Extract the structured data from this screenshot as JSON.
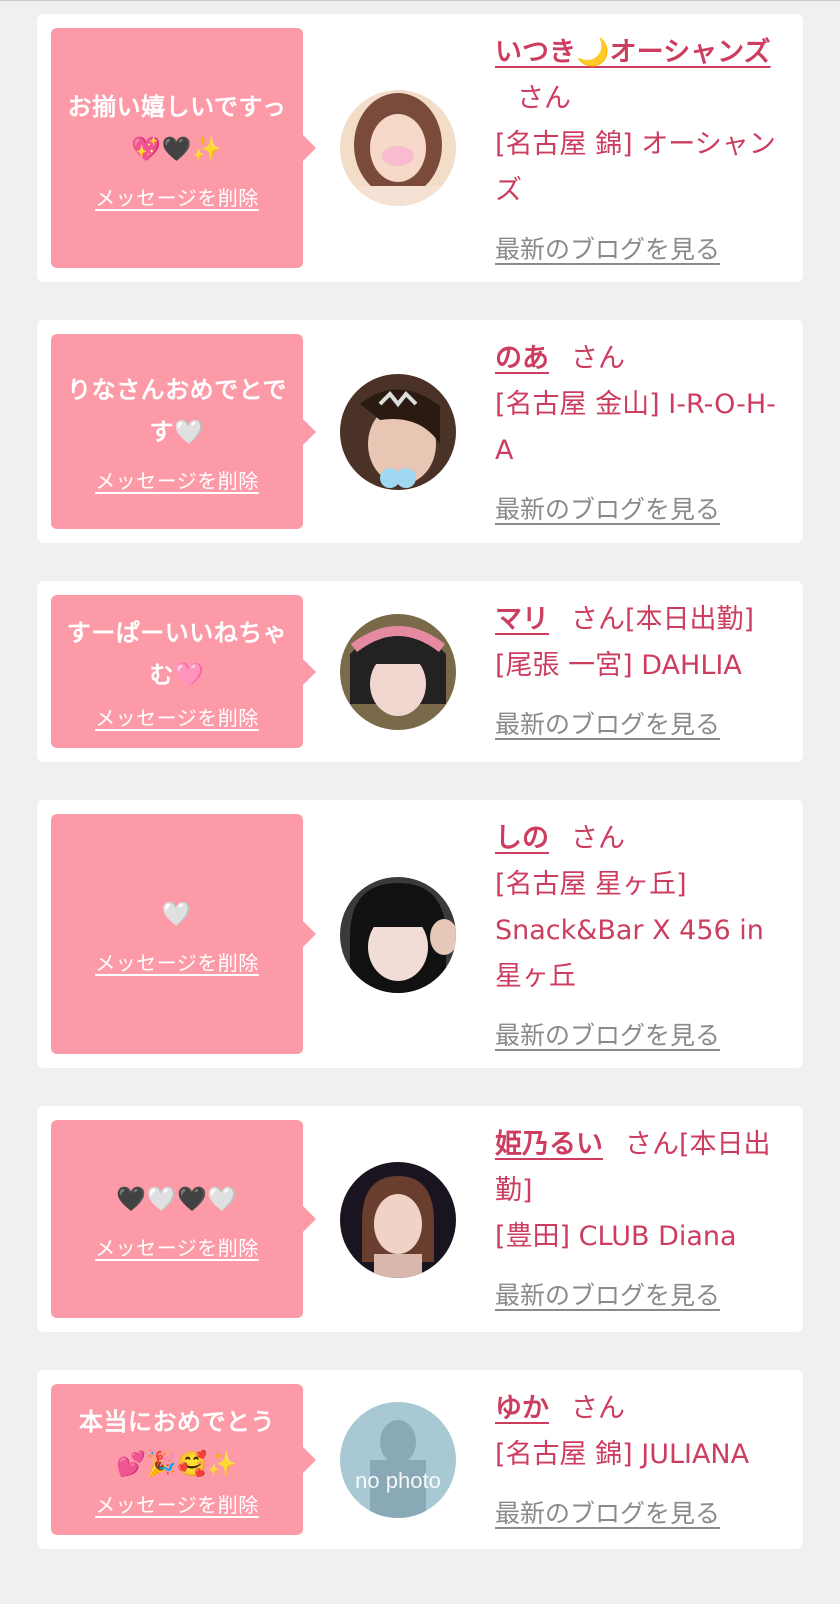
{
  "cards": [
    {
      "message": "お揃い嬉しいですっ 💖🖤✨",
      "delete_label": "メッセージを削除",
      "name": "いつき🌙オーシャンズ",
      "honorific": "さん",
      "shop": "[名古屋 錦] オーシャンズ",
      "blog_label": "最新のブログを見る"
    },
    {
      "message": "りなさんおめでとです🤍",
      "delete_label": "メッセージを削除",
      "name": "のあ",
      "honorific": "さん",
      "shop": "[名古屋 金山] I-R-O-H-A",
      "blog_label": "最新のブログを見る"
    },
    {
      "message": "すーぱーいいねちゃむ🩷",
      "delete_label": "メッセージを削除",
      "name": "マリ",
      "honorific": "さん[本日出勤]",
      "shop": "[尾張 一宮] DAHLIA",
      "blog_label": "最新のブログを見る"
    },
    {
      "message": "🤍",
      "delete_label": "メッセージを削除",
      "name": "しの",
      "honorific": "さん",
      "shop": "[名古屋 星ヶ丘] Snack&Bar X 456 in 星ヶ丘",
      "blog_label": "最新のブログを見る"
    },
    {
      "message": "🖤🤍🖤🤍",
      "delete_label": "メッセージを削除",
      "name": "姫乃るい",
      "honorific": "さん[本日出勤]",
      "shop": "[豊田] CLUB Diana",
      "blog_label": "最新のブログを見る"
    },
    {
      "message": "本当におめでとう 💕🎉🥰✨",
      "delete_label": "メッセージを削除",
      "name": "ゆか",
      "honorific": "さん",
      "shop": "[名古屋 錦] JULIANA",
      "blog_label": "最新のブログを見る",
      "avatar_text": "no photo"
    }
  ],
  "colors": {
    "background": "#f0f0f0",
    "card": "#ffffff",
    "bubble": "#fd9aa8",
    "accent": "#cc3d5f",
    "link_gray": "#8a8a8a"
  }
}
